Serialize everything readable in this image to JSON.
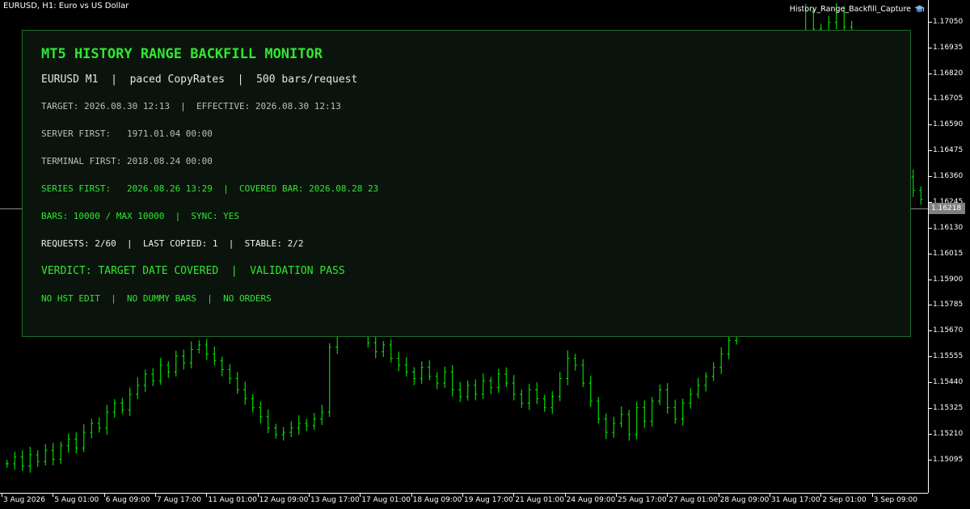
{
  "chart": {
    "title": "EURUSD, H1:  Euro vs US Dollar",
    "ea_name": "History_Range_Backfill_Capture",
    "ea_icon": "graduation-cap-icon",
    "current_price": "1.16218",
    "colors": {
      "background": "#000000",
      "candle": "#00ff00",
      "axis_text": "#ffffff",
      "price_marker": "#808080"
    }
  },
  "chart_data": {
    "type": "candlestick",
    "symbol": "EURUSD",
    "timeframe": "H1",
    "title": "EURUSD, H1:  Euro vs US Dollar",
    "ylim": [
      1.1495,
      1.1715
    ],
    "y_ticks": [
      "1.17050",
      "1.16935",
      "1.16820",
      "1.16705",
      "1.16590",
      "1.16475",
      "1.16360",
      "1.16245",
      "1.16130",
      "1.16015",
      "1.15900",
      "1.15785",
      "1.15670",
      "1.15555",
      "1.15440",
      "1.15325",
      "1.15210",
      "1.15095"
    ],
    "x_ticks": [
      "3 Aug 2026",
      "5 Aug 01:00",
      "6 Aug 09:00",
      "7 Aug 17:00",
      "11 Aug 01:00",
      "12 Aug 09:00",
      "13 Aug 17:00",
      "17 Aug 01:00",
      "18 Aug 09:00",
      "19 Aug 17:00",
      "21 Aug 01:00",
      "24 Aug 09:00",
      "25 Aug 17:00",
      "27 Aug 01:00",
      "28 Aug 09:00",
      "31 Aug 17:00",
      "2 Sep 01:00",
      "3 Sep 09:00"
    ],
    "last_price": 1.16218,
    "series": [
      {
        "name": "EURUSD",
        "close": [
          1.1508,
          1.1511,
          1.1507,
          1.1512,
          1.1509,
          1.1514,
          1.151,
          1.1516,
          1.1519,
          1.1515,
          1.1522,
          1.1526,
          1.1524,
          1.1531,
          1.1535,
          1.1532,
          1.1539,
          1.1543,
          1.1548,
          1.1545,
          1.1552,
          1.1549,
          1.1556,
          1.1553,
          1.1559,
          1.1561,
          1.1557,
          1.1554,
          1.155,
          1.1546,
          1.1541,
          1.1537,
          1.1533,
          1.1529,
          1.1524,
          1.1521,
          1.1522,
          1.1524,
          1.1526,
          1.1525,
          1.1528,
          1.1531,
          1.156,
          1.1572,
          1.1568,
          1.1575,
          1.1569,
          1.1562,
          1.1558,
          1.1561,
          1.1555,
          1.1552,
          1.1549,
          1.1546,
          1.1551,
          1.1547,
          1.1544,
          1.1549,
          1.1541,
          1.1538,
          1.1543,
          1.1539,
          1.1545,
          1.1542,
          1.1548,
          1.1544,
          1.1539,
          1.1535,
          1.1541,
          1.1537,
          1.1533,
          1.1538,
          1.1546,
          1.1555,
          1.1552,
          1.1544,
          1.1536,
          1.1528,
          1.1522,
          1.1526,
          1.153,
          1.1521,
          1.1533,
          1.1527,
          1.1536,
          1.1541,
          1.1533,
          1.1528,
          1.1535,
          1.1539,
          1.1543,
          1.1547,
          1.1551,
          1.1557,
          1.1563,
          1.1569,
          1.1574,
          1.1577,
          1.1583,
          1.1589,
          1.1604,
          1.1625,
          1.1658,
          1.1689,
          1.171,
          1.1702,
          1.1694,
          1.1705,
          1.171,
          1.1703,
          1.169,
          1.1676,
          1.1662,
          1.1655,
          1.1648,
          1.1652,
          1.1641,
          1.1636,
          1.163,
          1.1626
        ]
      }
    ]
  },
  "monitor": {
    "title": "MT5 HISTORY RANGE BACKFILL MONITOR",
    "subtitle": "EURUSD M1  |  paced CopyRates  |  500 bars/request",
    "target_line": "TARGET: 2026.08.30 12:13  |  EFFECTIVE: 2026.08.30 12:13",
    "server_first_line": "SERVER FIRST:   1971.01.04 00:00",
    "terminal_first_line": "TERMINAL FIRST: 2018.08.24 00:00",
    "series_first_line": "SERIES FIRST:   2026.08.26 13:29  |  COVERED BAR: 2026.08.28 23",
    "bars_line": "BARS: 10000 / MAX 10000  |  SYNC: YES",
    "requests_line": "REQUESTS: 2/60  |  LAST COPIED: 1  |  STABLE: 2/2",
    "verdict_line": "VERDICT: TARGET DATE COVERED  |  VALIDATION PASS",
    "footer_line": "NO HST EDIT  |  NO DUMMY BARS  |  NO ORDERS"
  }
}
